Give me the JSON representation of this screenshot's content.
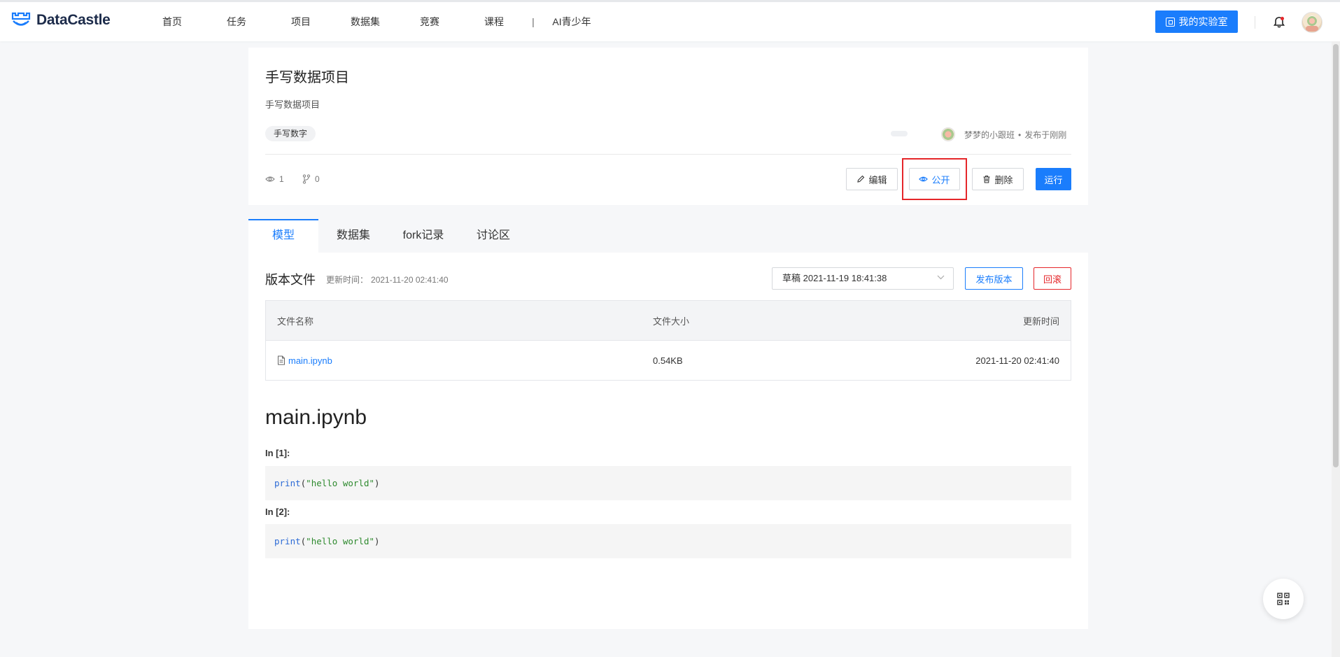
{
  "header": {
    "logo_text": "DataCastle",
    "nav": [
      "首页",
      "任务",
      "项目",
      "数据集",
      "竞赛",
      "课程"
    ],
    "nav_separator": "|",
    "nav_ai": "AI青少年",
    "lab_button": "我的实验室"
  },
  "project": {
    "title": "手写数据项目",
    "description": "手写数据项目",
    "tag": "手写数字",
    "author": "梦梦的小跟班",
    "published": "发布于刚刚",
    "views": "1",
    "forks": "0",
    "buttons": {
      "edit": "编辑",
      "public": "公开",
      "delete": "删除",
      "run": "运行"
    }
  },
  "tabs": [
    "模型",
    "数据集",
    "fork记录",
    "讨论区"
  ],
  "version": {
    "title": "版本文件",
    "updated_label": "更新时间：",
    "updated_time": "2021-11-20 02:41:40",
    "selected_version": "草稿 2021-11-19 18:41:38",
    "publish_button": "发布版本",
    "rollback_button": "回滚"
  },
  "files_table": {
    "headers": [
      "文件名称",
      "文件大小",
      "更新时间"
    ],
    "rows": [
      {
        "name": "main.ipynb",
        "size": "0.54KB",
        "time": "2021-11-20 02:41:40"
      }
    ]
  },
  "notebook": {
    "title": "main.ipynb",
    "cells": [
      {
        "label": "In [1]:",
        "func": "print",
        "open": "(",
        "arg": "\"hello world\"",
        "close": ")"
      },
      {
        "label": "In [2]:",
        "func": "print",
        "open": "(",
        "arg": "\"hello world\"",
        "close": ")"
      }
    ]
  },
  "colors": {
    "accent": "#1a7dfc",
    "danger": "#e5262a",
    "highlight_box": "#e5262a"
  },
  "icons": [
    "datacastle-logo-icon",
    "lab-icon",
    "bell-icon",
    "avatar",
    "eye-icon",
    "fork-icon",
    "pencil-icon",
    "trash-icon",
    "chevron-down-icon",
    "file-icon",
    "qr-code-icon"
  ]
}
